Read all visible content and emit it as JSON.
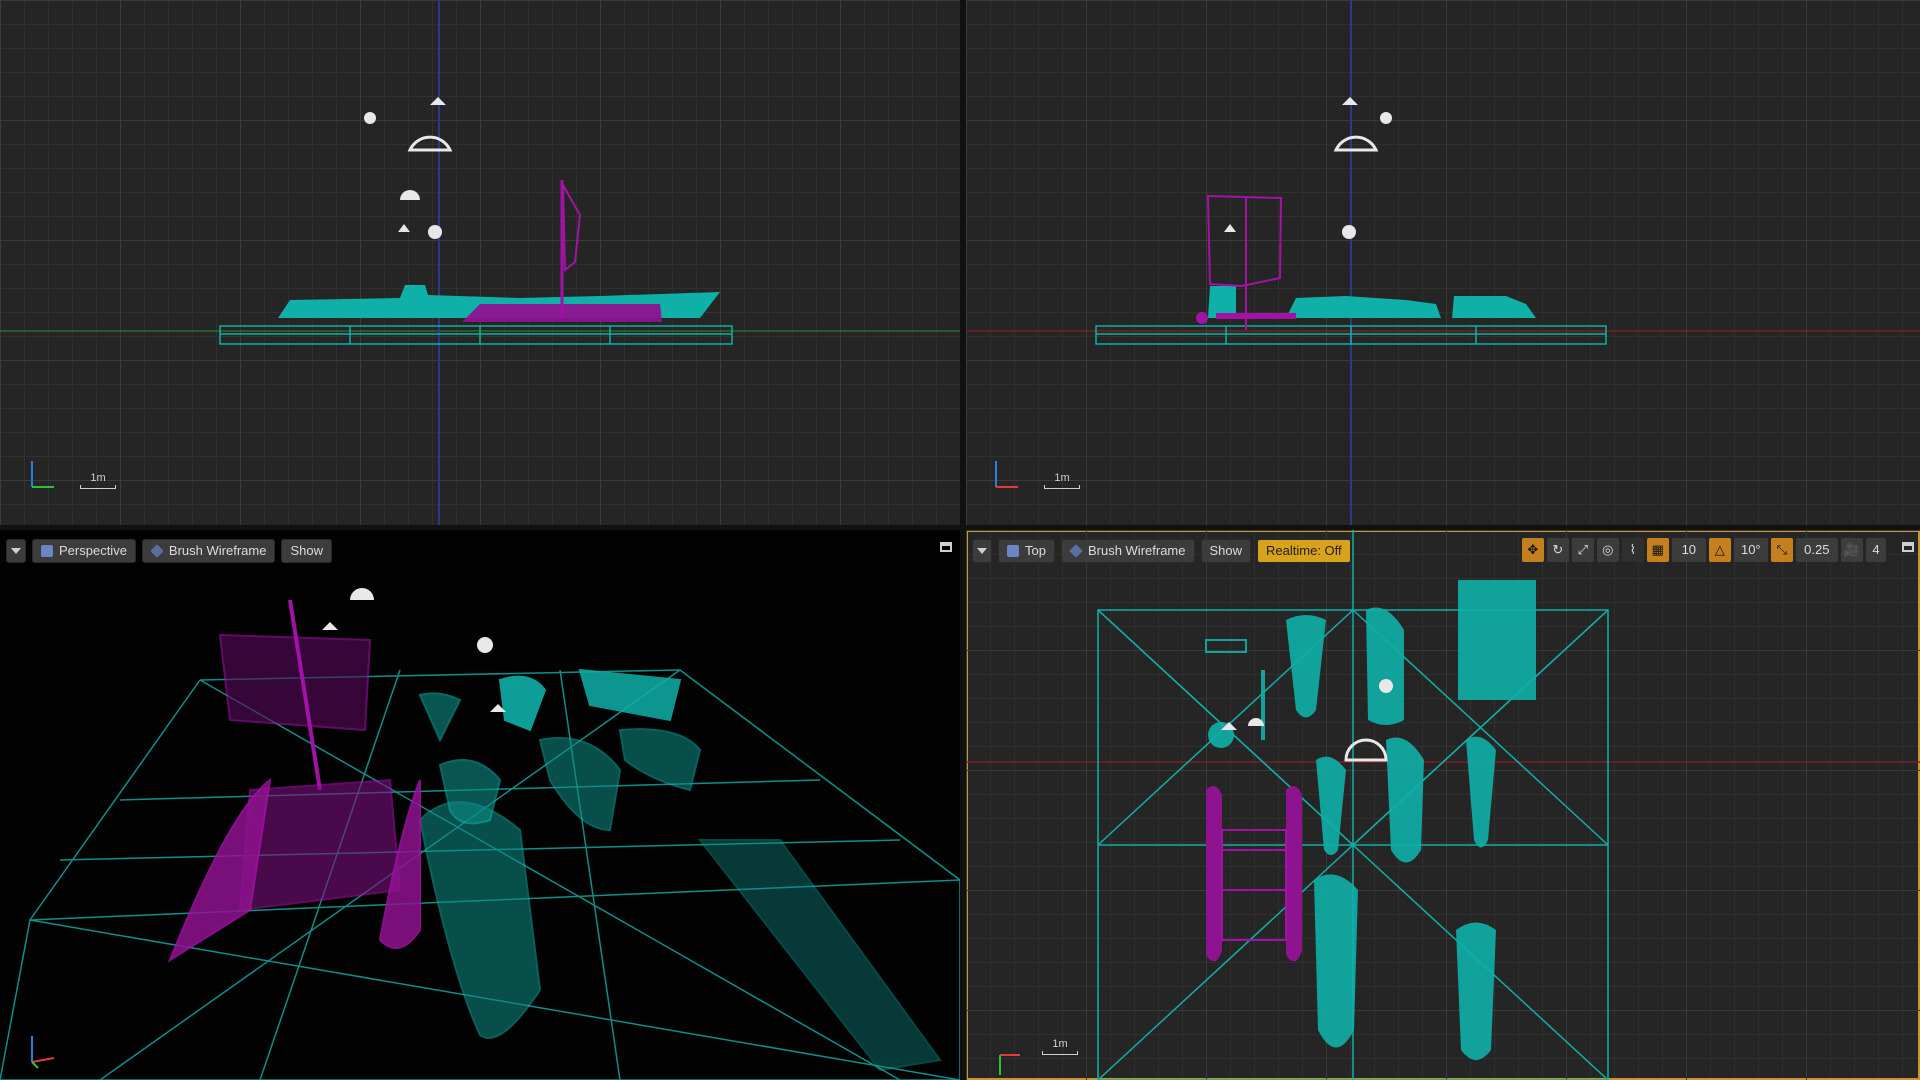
{
  "viewports": {
    "left": {
      "scale_label": "1m",
      "axis_vertical": "Z",
      "axis_horizontal": "Y"
    },
    "front": {
      "scale_label": "1m",
      "axis_vertical": "Z",
      "axis_horizontal": "X"
    },
    "perspective": {
      "view_mode": "Perspective",
      "render_mode": "Brush Wireframe",
      "show_label": "Show",
      "axis_vertical": "Z",
      "axis_horizontal": "X"
    },
    "top": {
      "view_mode": "Top",
      "render_mode": "Brush Wireframe",
      "show_label": "Show",
      "realtime_label": "Realtime: Off",
      "grid_snap_value": "10",
      "rotation_snap_value": "10°",
      "scale_snap_value": "0.25",
      "camera_speed_value": "4",
      "scale_label": "1m",
      "axis_vertical": "Y",
      "axis_horizontal": "X"
    }
  },
  "colors": {
    "mesh_cyan": "#0fb0a8",
    "mesh_magenta": "#a312a6",
    "highlight_yellow": "#d8a21c",
    "grid_bg": "#252525",
    "perspective_bg": "#020202"
  }
}
